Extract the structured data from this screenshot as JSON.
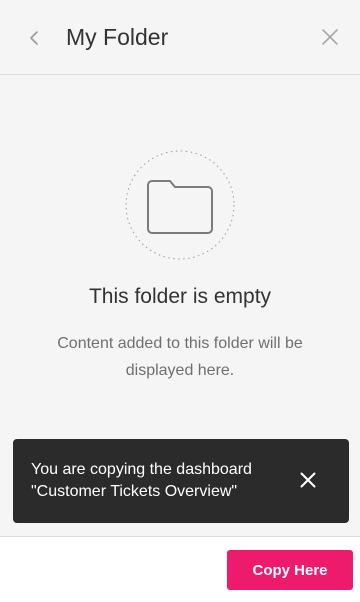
{
  "header": {
    "title": "My Folder",
    "back_icon": "chevron-left-icon",
    "close_icon": "close-icon"
  },
  "empty_state": {
    "illustration_icon": "folder-icon",
    "title": "This folder is empty",
    "description": "Content added to this folder will be displayed here."
  },
  "toast": {
    "message": "You are copying the dashboard \"Customer Tickets Overview\"",
    "close_icon": "close-icon"
  },
  "footer": {
    "copy_label": "Copy Here"
  },
  "colors": {
    "accent": "#ee1a6b",
    "toast_bg": "#2b2b2b",
    "background": "#f5f5f5"
  }
}
